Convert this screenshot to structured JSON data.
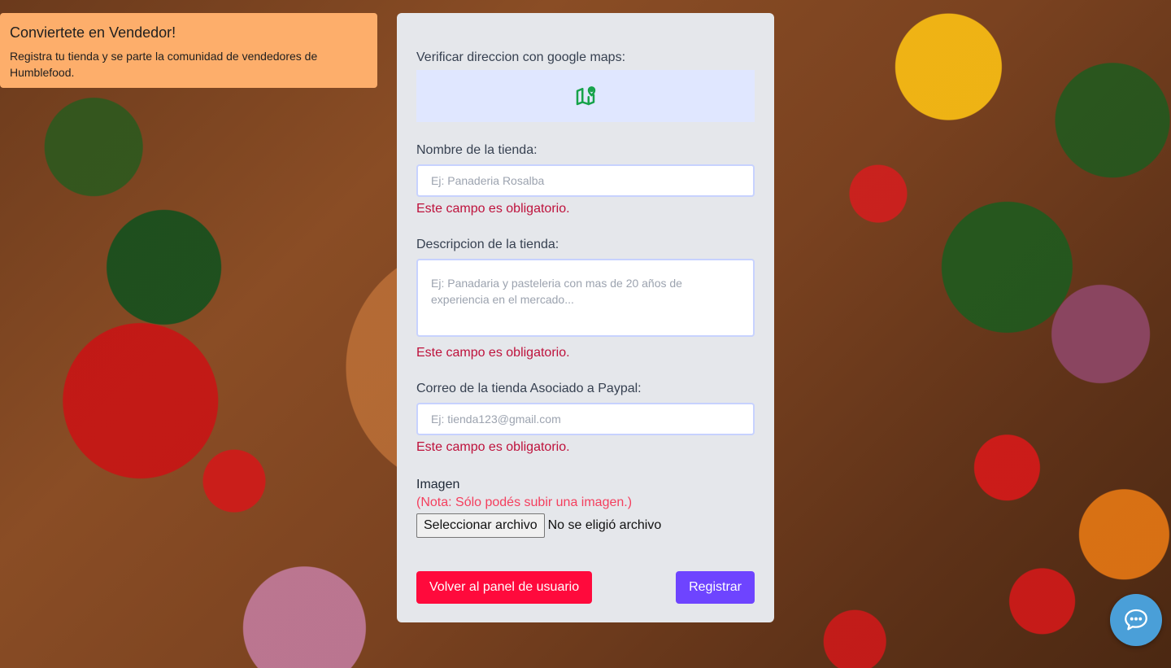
{
  "banner": {
    "title": "Conviertete en Vendedor!",
    "text": "Registra tu tienda y se parte la comunidad de vendedores de Humblefood."
  },
  "form": {
    "map": {
      "label": "Verificar direccion con google maps:",
      "icon": "map-pin-icon",
      "icon_color": "#16a34a"
    },
    "store_name": {
      "label": "Nombre de la tienda:",
      "placeholder": "Ej: Panaderia Rosalba",
      "value": "",
      "error": "Este campo es obligatorio."
    },
    "description": {
      "label": "Descripcion de la tienda:",
      "placeholder": "Ej: Panadaria y pasteleria con mas de 20 años de experiencia en el mercado...",
      "value": "",
      "error": "Este campo es obligatorio."
    },
    "email": {
      "label": "Correo de la tienda Asociado a Paypal:",
      "placeholder": "Ej: tienda123@gmail.com",
      "value": "",
      "error": "Este campo es obligatorio."
    },
    "image": {
      "label": "Imagen",
      "note": "(Nota: Sólo podés subir una imagen.)",
      "button_label": "Seleccionar archivo",
      "status": "No se eligió archivo"
    },
    "actions": {
      "back_label": "Volver al panel de usuario",
      "register_label": "Registrar"
    }
  },
  "chat": {
    "icon": "chat-bubble-icon",
    "color": "#4a9fd8"
  },
  "colors": {
    "banner_bg": "#fdae6b",
    "panel_bg": "#e5e7eb",
    "error": "#be123c",
    "note": "#f43f5e",
    "back_button": "#ff0a3c",
    "register_button": "#6e44ff"
  }
}
